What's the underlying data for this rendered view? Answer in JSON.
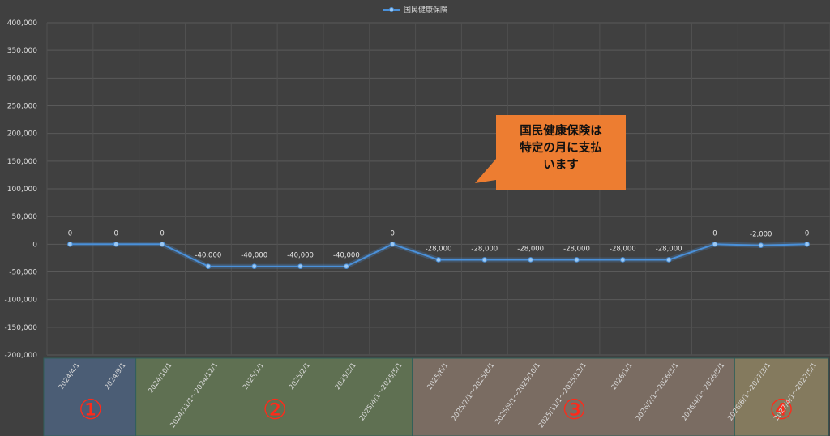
{
  "chart_data": {
    "type": "line",
    "series": [
      {
        "name": "国民健康保険",
        "values": [
          0,
          0,
          0,
          -40000,
          -40000,
          -40000,
          -40000,
          0,
          -28000,
          -28000,
          -28000,
          -28000,
          -28000,
          -28000,
          0,
          -2000,
          0
        ],
        "labels": [
          "0",
          "0",
          "0",
          "-40,000",
          "-40,000",
          "-40,000",
          "-40,000",
          "0",
          "-28,000",
          "-28,000",
          "-28,000",
          "-28,000",
          "-28,000",
          "-28,000",
          "0",
          "-2,000",
          "0"
        ]
      }
    ],
    "categories": [
      "2024/4/1",
      "2024/9/1",
      "2024/10/1",
      "2024/11/1～2024/12/1",
      "2025/1/1",
      "2025/2/1",
      "2025/3/1",
      "2025/4/1～2025/5/1",
      "2025/6/1",
      "2025/7/1～2025/8/1",
      "2025/9/1～2025/10/1",
      "2025/11/1～2025/12/1",
      "2026/1/1",
      "2026/2/1～2026/3/1",
      "2026/4/1～2026/5/1",
      "2026/6/1～2027/3/1",
      "2027/4/1～2027/5/1"
    ],
    "yticks": [
      "400,000",
      "350,000",
      "300,000",
      "250,000",
      "200,000",
      "150,000",
      "100,000",
      "50,000",
      "0",
      "-50,000",
      "-100,000",
      "-150,000",
      "-200,000"
    ],
    "ylim": [
      -200000,
      400000
    ],
    "grid": true,
    "legend_position": "top-center",
    "title": "",
    "xlabel": "",
    "ylabel": "",
    "line_color": "#4a90d9"
  },
  "callout": {
    "lines": [
      "国民健康保険は",
      "特定の月に支払",
      "います"
    ],
    "color": "#ed7d31"
  },
  "regions": [
    {
      "label": "①",
      "start": 0,
      "end": 1,
      "color": "#4b5d75"
    },
    {
      "label": "②",
      "start": 2,
      "end": 7,
      "color": "#5f7052"
    },
    {
      "label": "③",
      "start": 8,
      "end": 14,
      "color": "#7a6c62"
    },
    {
      "label": "④",
      "start": 15,
      "end": 16,
      "color": "#847a5e"
    }
  ]
}
